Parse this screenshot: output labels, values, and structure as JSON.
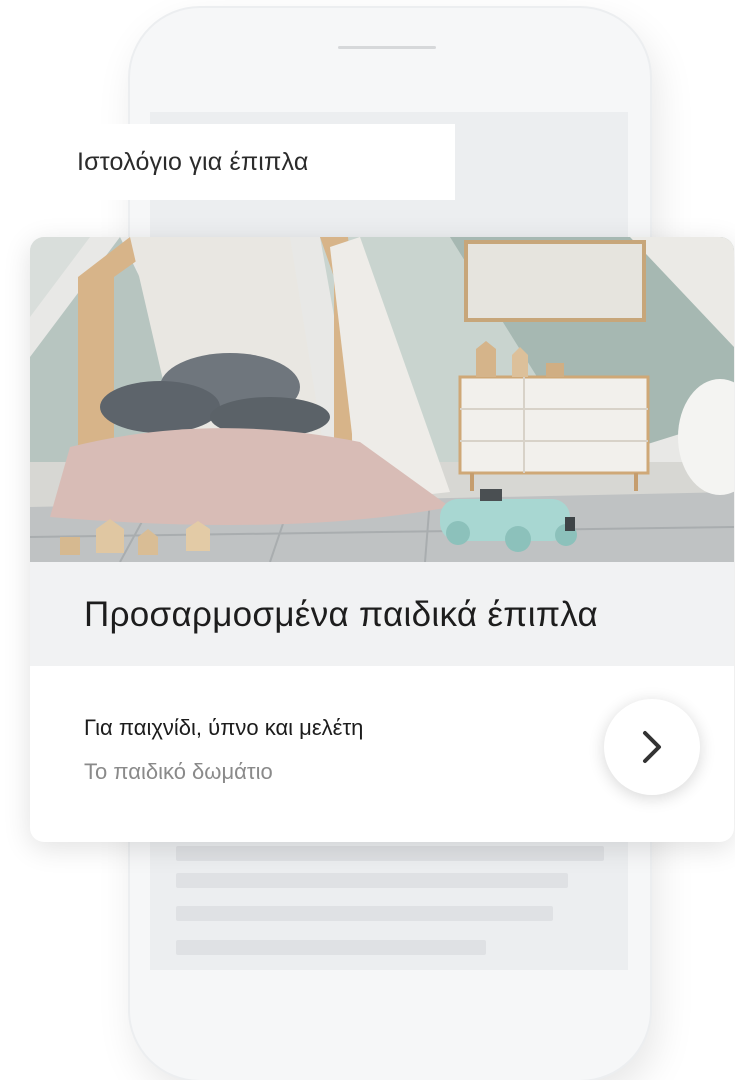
{
  "header": {
    "title": "Ιστολόγιο για έπιπλα"
  },
  "card": {
    "headline": "Προσαρμοσμένα παιδικά έπιπλα",
    "description": "Για παιχνίδι, ύπνο και μελέτη",
    "subtitle": "Το παιδικό δωμάτιο",
    "image_icon": "kids-bedroom-image",
    "arrow_icon": "chevron-right-icon"
  },
  "colors": {
    "background": "#ffffff",
    "phone_body": "#f6f7f8",
    "screen": "#eceef0",
    "headline_band": "#f1f2f3",
    "subtitle_text": "#8a8a8a"
  }
}
